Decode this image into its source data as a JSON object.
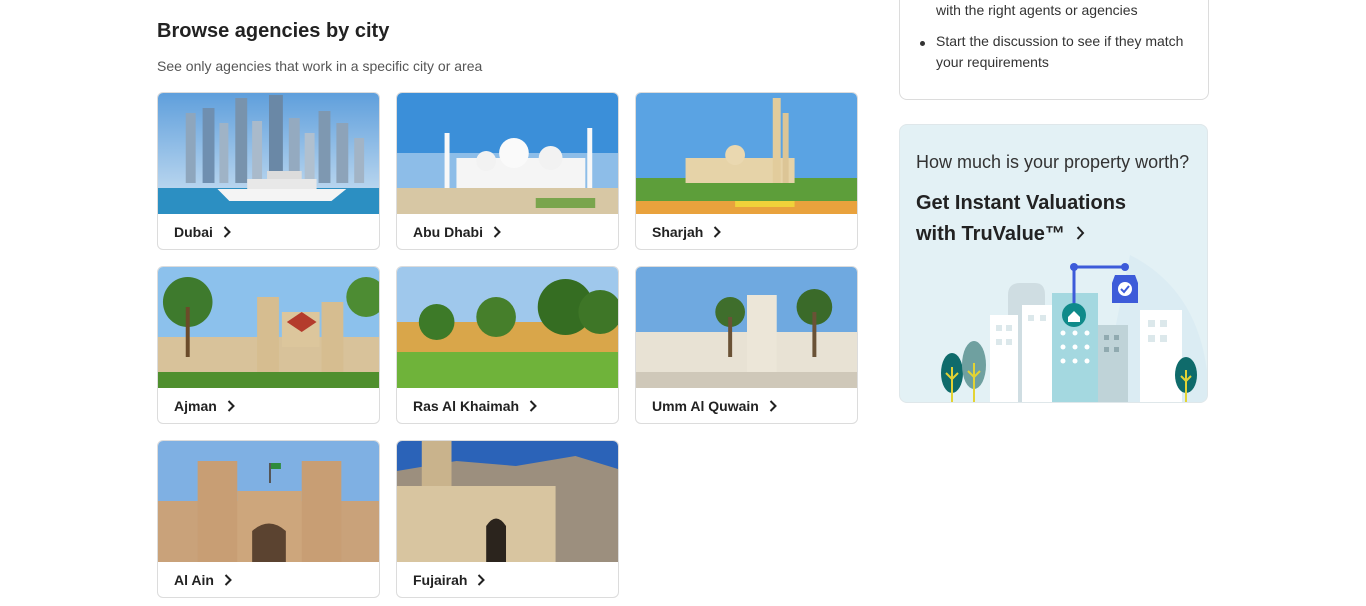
{
  "browse": {
    "title": "Browse agencies by city",
    "subtitle": "See only agencies that work in a specific city or area",
    "cities": [
      {
        "label": "Dubai",
        "icon": "chevron-right-icon"
      },
      {
        "label": "Abu Dhabi",
        "icon": "chevron-right-icon"
      },
      {
        "label": "Sharjah",
        "icon": "chevron-right-icon"
      },
      {
        "label": "Ajman",
        "icon": "chevron-right-icon"
      },
      {
        "label": "Ras Al Khaimah",
        "icon": "chevron-right-icon"
      },
      {
        "label": "Umm Al Quwain",
        "icon": "chevron-right-icon"
      },
      {
        "label": "Al Ain",
        "icon": "chevron-right-icon"
      },
      {
        "label": "Fujairah",
        "icon": "chevron-right-icon"
      }
    ]
  },
  "tips": {
    "line1": "with the right agents or agencies",
    "bullet2_line1": "Start the discussion to see if they match",
    "bullet2_line2": "your requirements"
  },
  "promo": {
    "question": "How much is your property worth?",
    "headline_line1": "Get Instant Valuations",
    "headline_line2": "with TruValue™",
    "background_color": "#e3f1f5"
  }
}
